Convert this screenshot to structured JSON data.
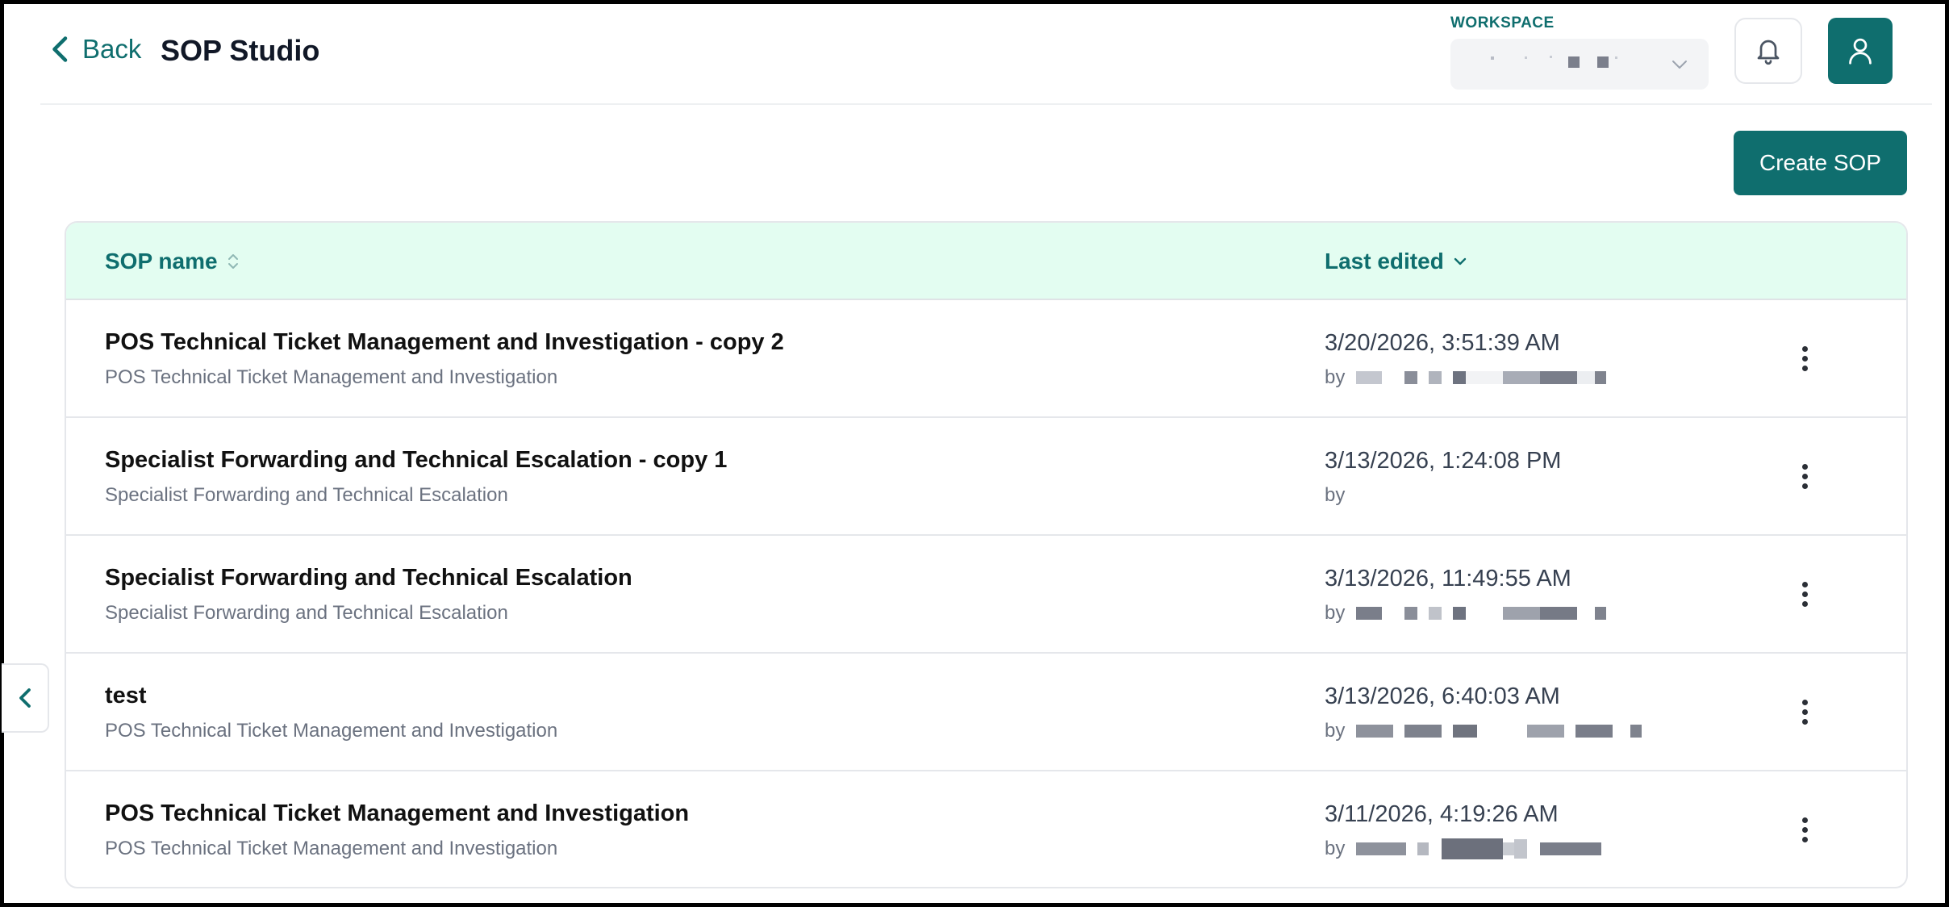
{
  "header": {
    "back_label": "Back",
    "title": "SOP Studio",
    "workspace_label": "WORKSPACE",
    "workspace_value": ""
  },
  "actions": {
    "create_label": "Create SOP"
  },
  "table": {
    "columns": {
      "name": "SOP name",
      "last_edited": "Last edited"
    },
    "rows": [
      {
        "title": "POS Technical Ticket Management and Investigation - copy 2",
        "subtitle": "POS Technical Ticket Management and Investigation",
        "edited": "3/20/2026, 3:51:39 AM",
        "by": "by"
      },
      {
        "title": "Specialist Forwarding and Technical Escalation - copy 1",
        "subtitle": "Specialist Forwarding and Technical Escalation",
        "edited": "3/13/2026, 1:24:08 PM",
        "by": "by"
      },
      {
        "title": "Specialist Forwarding and Technical Escalation",
        "subtitle": "Specialist Forwarding and Technical Escalation",
        "edited": "3/13/2026, 11:49:55 AM",
        "by": "by"
      },
      {
        "title": "test",
        "subtitle": "POS Technical Ticket Management and Investigation",
        "edited": "3/13/2026, 6:40:03 AM",
        "by": "by"
      },
      {
        "title": "POS Technical Ticket Management and Investigation",
        "subtitle": "POS Technical Ticket Management and Investigation",
        "edited": "3/11/2026, 4:19:26 AM",
        "by": "by"
      }
    ]
  },
  "colors": {
    "accent": "#0f6e6e",
    "header_bg": "#e3fdf1",
    "muted_text": "#6b7280"
  }
}
